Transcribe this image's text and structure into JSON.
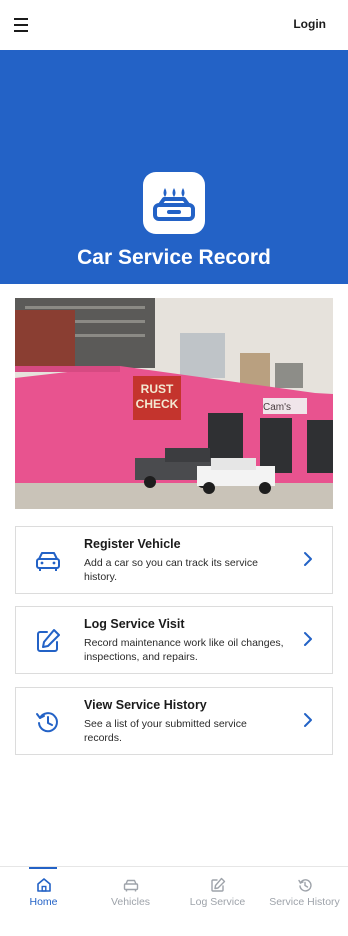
{
  "header": {
    "login_label": "Login"
  },
  "hero": {
    "title": "Car Service Record"
  },
  "photo": {
    "sign_lines": [
      "RUST",
      "CHECK"
    ],
    "shop_sign": "Cam's"
  },
  "cards": [
    {
      "title": "Register Vehicle",
      "description": "Add a car so you can track its service history."
    },
    {
      "title": "Log Service Visit",
      "description": "Record maintenance work like oil changes, inspections, and repairs."
    },
    {
      "title": "View Service History",
      "description": "See a list of your submitted service records."
    }
  ],
  "nav": [
    {
      "label": "Home",
      "icon": "home-icon",
      "active": true
    },
    {
      "label": "Vehicles",
      "icon": "car-icon",
      "active": false
    },
    {
      "label": "Log Service",
      "icon": "edit-icon",
      "active": false
    },
    {
      "label": "Service History",
      "icon": "history-icon",
      "active": false
    }
  ],
  "colors": {
    "primary": "#2362c6",
    "inactive": "#9ea3aa"
  }
}
